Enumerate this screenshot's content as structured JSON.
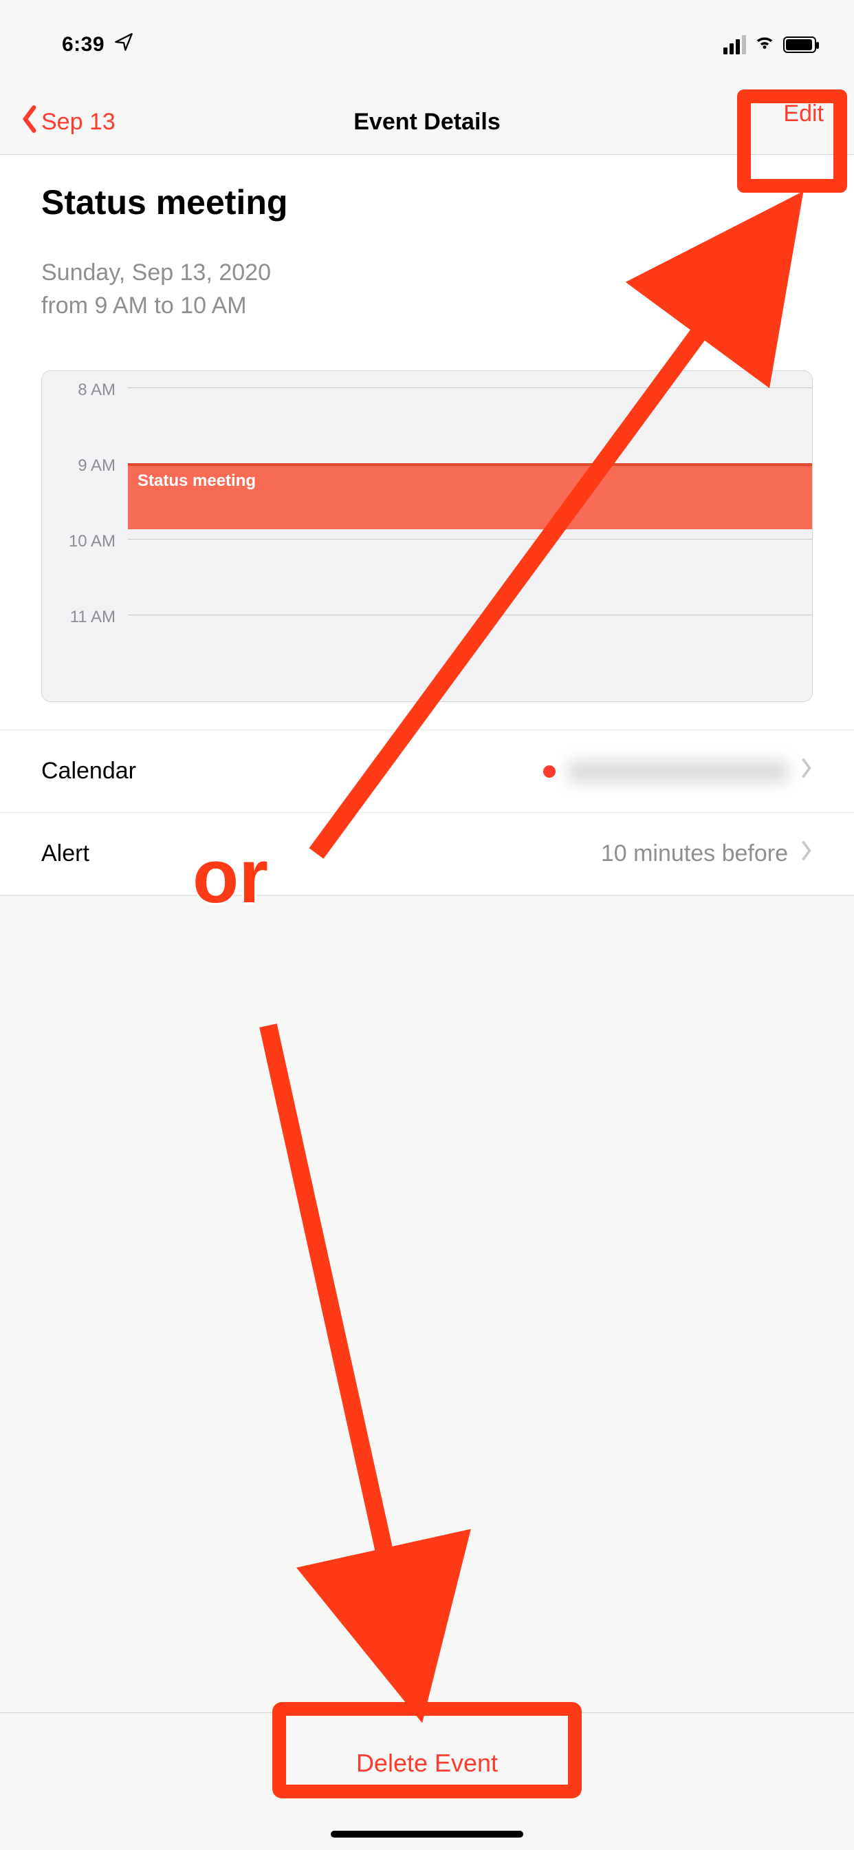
{
  "status": {
    "time": "6:39"
  },
  "nav": {
    "back_label": "Sep 13",
    "title": "Event Details",
    "edit_label": "Edit"
  },
  "event": {
    "title": "Status meeting",
    "date_line": "Sunday, Sep 13, 2020",
    "time_line": "from 9 AM to 10 AM"
  },
  "timeline": {
    "hours": [
      "8 AM",
      "9 AM",
      "10 AM",
      "11 AM"
    ],
    "block_label": "Status meeting",
    "block_start_index": 1,
    "block_span_hours": 1
  },
  "rows": {
    "calendar": {
      "label": "Calendar",
      "account_redacted": true
    },
    "alert": {
      "label": "Alert",
      "value": "10 minutes before"
    }
  },
  "toolbar": {
    "delete_label": "Delete Event"
  },
  "annotation": {
    "or_label": "or"
  },
  "colors": {
    "accent": "#ff3b30",
    "event_block": "#f76b55"
  }
}
